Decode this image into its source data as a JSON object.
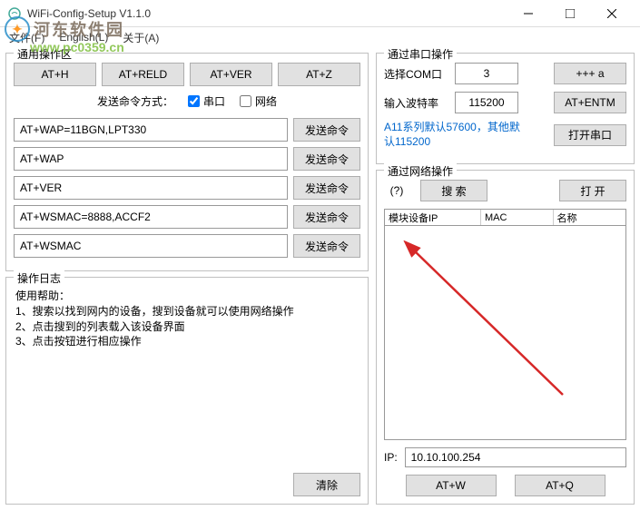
{
  "titlebar": {
    "title": "WiFi-Config-Setup V1.1.0"
  },
  "menu": {
    "file": "文件(F)",
    "language": "English(L)",
    "about": "关于(A)"
  },
  "watermark": {
    "text": "河东软件园",
    "url": "www.pc0359.cn"
  },
  "ops": {
    "title": "通用操作区",
    "buttons": [
      "AT+H",
      "AT+RELD",
      "AT+VER",
      "AT+Z"
    ],
    "sendmode": {
      "label": "发送命令方式：",
      "serial": "串口",
      "net": "网络"
    },
    "rows": [
      {
        "value": "AT+WAP=11BGN,LPT330",
        "btn": "发送命令"
      },
      {
        "value": "AT+WAP",
        "btn": "发送命令"
      },
      {
        "value": "AT+VER",
        "btn": "发送命令"
      },
      {
        "value": "AT+WSMAC=8888,ACCF2",
        "btn": "发送命令"
      },
      {
        "value": "AT+WSMAC",
        "btn": "发送命令"
      }
    ]
  },
  "log": {
    "title": "操作日志",
    "help_title": "使用帮助：",
    "lines": [
      "1、搜索以找到网内的设备，搜到设备就可以使用网络操作",
      "2、点击搜到的列表载入该设备界面",
      "3、点击按钮进行相应操作"
    ],
    "clear": "清除"
  },
  "serial": {
    "title": "通过串口操作",
    "com_label": "选择COM口",
    "com_value": "3",
    "btn_a": "+++ a",
    "baud_label": "输入波特率",
    "baud_value": "115200",
    "btn_entm": "AT+ENTM",
    "note": "A11系列默认57600，其他默认115200",
    "btn_open": "打开串口"
  },
  "net": {
    "title": "通过网络操作",
    "question": "(?)",
    "search": "搜 索",
    "open": "打 开",
    "col1": "模块设备IP",
    "col2": "MAC",
    "col3": "名称",
    "ip_label": "IP:",
    "ip_value": "10.10.100.254",
    "btn_w": "AT+W",
    "btn_q": "AT+Q"
  }
}
